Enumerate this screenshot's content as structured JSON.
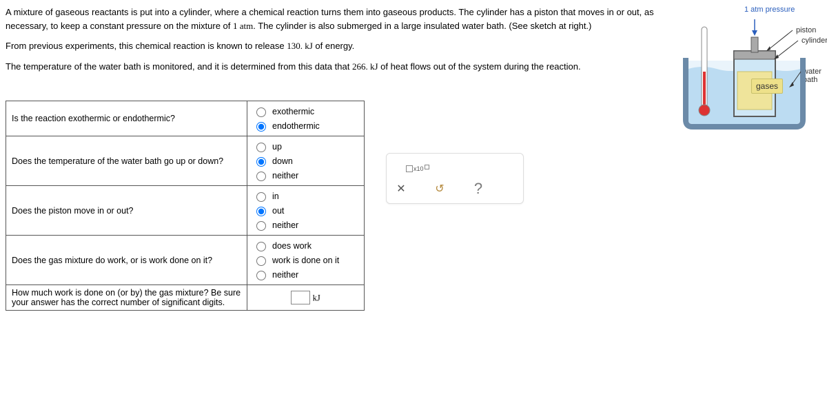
{
  "problem": {
    "p1a": "A mixture of gaseous reactants is put into a cylinder, where a chemical reaction turns them into gaseous products. The cylinder has a piston that moves in or out, as necessary, to keep a constant pressure on the mixture of ",
    "p1_val": "1 atm",
    "p1b": ". The cylinder is also submerged in a large insulated water bath. (See sketch at right.)",
    "p2a": "From previous experiments, this chemical reaction is known to release ",
    "p2_val": "130. kJ",
    "p2b": " of energy.",
    "p3a": "The temperature of the water bath is monitored, and it is determined from this data that ",
    "p3_val": "266. kJ",
    "p3b": " of heat flows out of the system during the reaction."
  },
  "diagram": {
    "pressure": "1 atm pressure",
    "piston": "piston",
    "cylinder": "cylinder",
    "waterbath": "water bath",
    "gases": "gases"
  },
  "questions": {
    "q1": {
      "text": "Is the reaction exothermic or endothermic?",
      "opt1": "exothermic",
      "opt2": "endothermic",
      "selected": 2
    },
    "q2": {
      "text": "Does the temperature of the water bath go up or down?",
      "opt1": "up",
      "opt2": "down",
      "opt3": "neither",
      "selected": 2
    },
    "q3": {
      "text": "Does the piston move in or out?",
      "opt1": "in",
      "opt2": "out",
      "opt3": "neither",
      "selected": 2
    },
    "q4": {
      "text": "Does the gas mixture do work, or is work done on it?",
      "opt1": "does work",
      "opt2": "work is done on it",
      "opt3": "neither",
      "selected": 0
    },
    "q5": {
      "text": "How much work is done on (or by) the gas mixture? Be sure your answer has the correct number of significant digits.",
      "unit": "kJ",
      "value": ""
    }
  },
  "toolbox": {
    "x10": "x10",
    "close": "✕",
    "undo": "↺",
    "help": "?"
  }
}
